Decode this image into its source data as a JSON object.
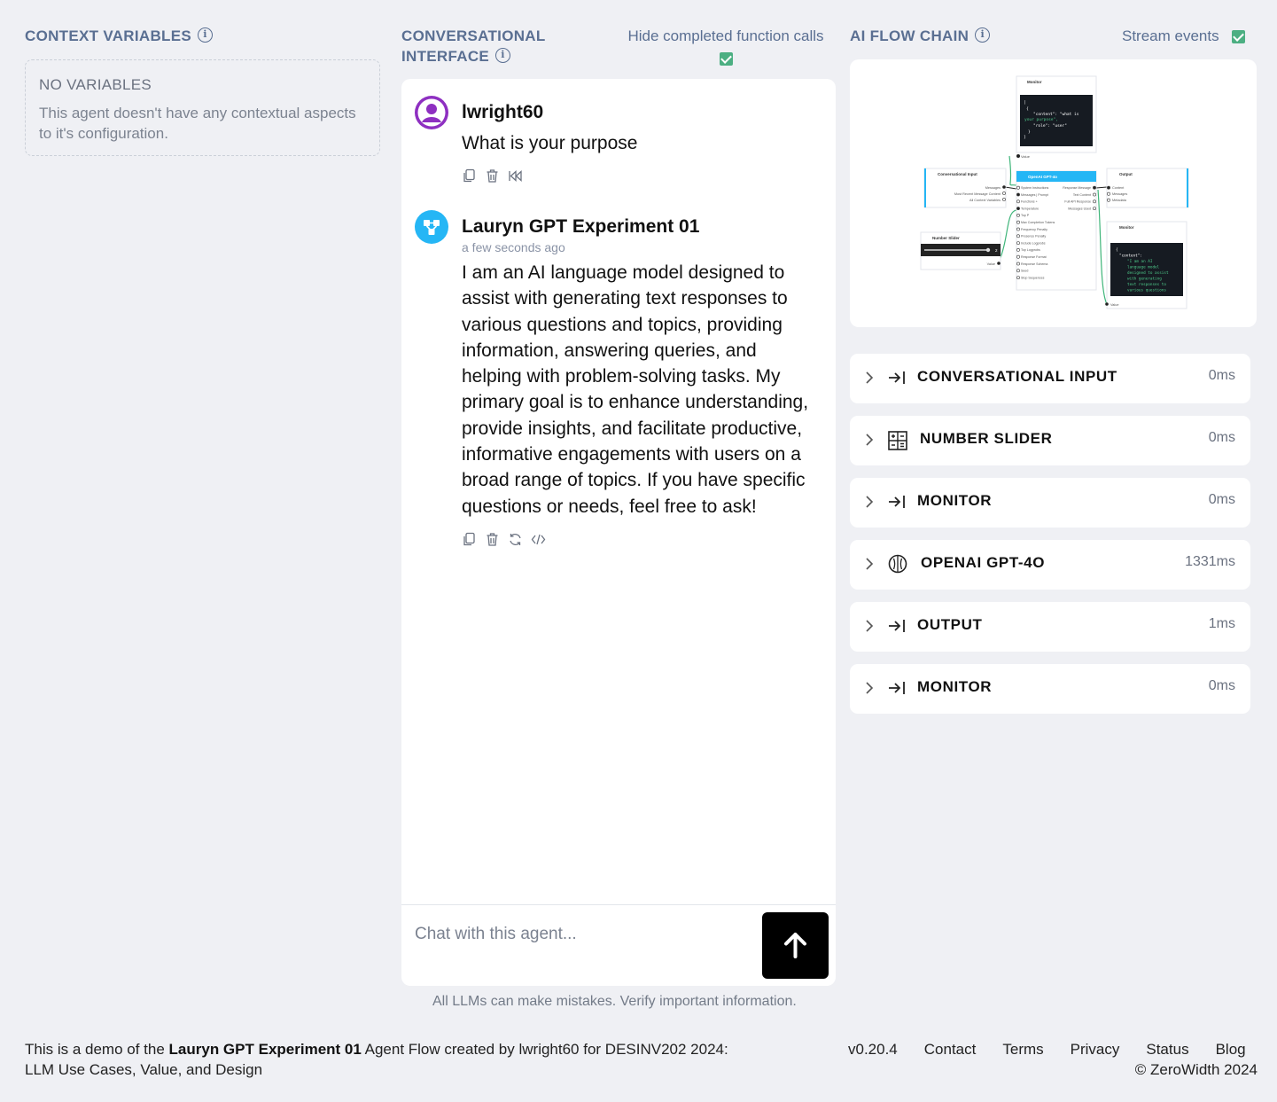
{
  "context": {
    "title": "CONTEXT VARIABLES",
    "empty_title": "NO VARIABLES",
    "empty_text": "This agent doesn't have any contextual aspects to it's configuration."
  },
  "chat": {
    "title_line1": "CONVERSATIONAL",
    "title_line2": "INTERFACE",
    "hide_label": "Hide completed function calls",
    "hide_checked": true,
    "messages": [
      {
        "author": "lwright60",
        "time": "",
        "text": "What is your purpose"
      },
      {
        "author": "Lauryn GPT Experiment 01",
        "time": "a few seconds ago",
        "text": "I am an AI language model designed to assist with generating text responses to various questions and topics, providing information, answering queries, and helping with problem-solving tasks. My primary goal is to enhance understanding, provide insights, and facilitate productive, informative engagements with users on a broad range of topics. If you have specific questions or needs, feel free to ask!"
      }
    ],
    "input_placeholder": "Chat with this agent...",
    "disclaimer": "All LLMs can make mistakes. Verify important information."
  },
  "flow": {
    "title": "AI FLOW CHAIN",
    "stream_label": "Stream events",
    "stream_checked": true,
    "preview": {
      "monitor_top_title": "Monitor",
      "monitor_top_code_1": "[",
      "monitor_top_code_2": "{",
      "monitor_top_code_3": "\"content\": \"what is",
      "monitor_top_code_4": "your purpose\",",
      "monitor_top_code_5": "\"role\": \"user\"",
      "monitor_top_code_6": "}",
      "monitor_top_code_7": "]",
      "value_label": "Value",
      "conv_input_title": "Conversational Input",
      "conv_input_ports": [
        "Messages",
        "Most Recent Message Content",
        "All Context Variables"
      ],
      "gpt_title": "OpenAI GPT-4o",
      "gpt_inputs": [
        "System Instructions",
        "Messages | Prompt",
        "Functions +",
        "Temperature",
        "Top P",
        "Max Completion Tokens",
        "Frequency Penalty",
        "Presence Penalty",
        "Include Logprobs",
        "Top Logprobs",
        "Response Format",
        "Response Schema",
        "Seed",
        "Stop Sequences"
      ],
      "gpt_outputs": [
        "Response Message",
        "Text Content",
        "Full API Response",
        "Messages Used"
      ],
      "output_title": "Output",
      "output_ports": [
        "Content",
        "Messages",
        "Metadata"
      ],
      "slider_title": "Number Slider",
      "slider_value": "2",
      "monitor_bottom_title": "Monitor",
      "monitor_bottom_code": [
        "{",
        "\"content\":",
        "\"I am an AI",
        "language model",
        "designed to assist",
        "with generating",
        "text responses to",
        "various questions"
      ]
    },
    "nodes": [
      {
        "label": "CONVERSATIONAL INPUT",
        "time": "0ms",
        "icon": "arrow-to-line-icon"
      },
      {
        "label": "NUMBER SLIDER",
        "time": "0ms",
        "icon": "grid-calculator-icon"
      },
      {
        "label": "MONITOR",
        "time": "0ms",
        "icon": "arrow-to-line-icon"
      },
      {
        "label": "OPENAI GPT-4O",
        "time": "1331ms",
        "icon": "openai-brain-icon"
      },
      {
        "label": "OUTPUT",
        "time": "1ms",
        "icon": "arrow-to-line-icon"
      },
      {
        "label": "MONITOR",
        "time": "0ms",
        "icon": "arrow-to-line-icon"
      }
    ]
  },
  "footer": {
    "prefix": "This is a demo of the ",
    "agent_name": "Lauryn GPT Experiment 01",
    "suffix_line1": " Agent Flow created by lwright60 for DESINV202 2024:",
    "line2": "LLM Use Cases, Value, and Design",
    "links": [
      "v0.20.4",
      "Contact",
      "Terms",
      "Privacy",
      "Status",
      "Blog"
    ],
    "copyright": "© ZeroWidth 2024"
  },
  "colors": {
    "section_title": "#5a6f92",
    "check": "#4caf82",
    "agent_avatar": "#25b6f5",
    "user_avatar": "#8e2fc1",
    "send_button": "#000000"
  }
}
